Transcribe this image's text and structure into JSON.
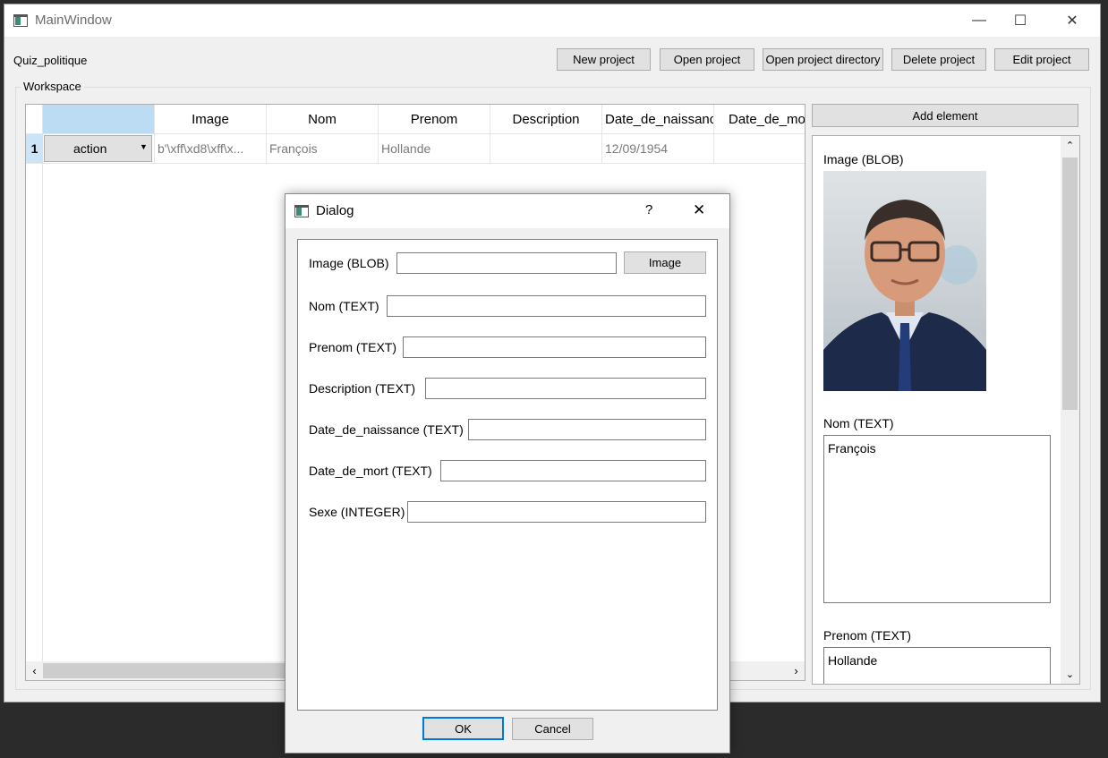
{
  "window": {
    "title": "MainWindow",
    "minimize_icon": "minimize-icon",
    "maximize_icon": "maximize-icon",
    "close_icon": "close-icon"
  },
  "toolbar": {
    "project_name": "Quiz_politique",
    "buttons": [
      "New project",
      "Open project",
      "Open project directory",
      "Delete project",
      "Edit project"
    ]
  },
  "workspace": {
    "group_label": "Workspace",
    "table": {
      "columns": [
        "Image",
        "Nom",
        "Prenom",
        "Description",
        "Date_de_naissance",
        "Date_de_mor"
      ],
      "rows": [
        {
          "row_number": "1",
          "action": "action",
          "cells": [
            "b'\\xff\\xd8\\xff\\x...",
            "François",
            "Hollande",
            "",
            "12/09/1954"
          ]
        }
      ]
    },
    "add_element_label": "Add element",
    "details": {
      "image_label": "Image (BLOB)",
      "nom_label": "Nom (TEXT)",
      "nom_value": "François",
      "prenom_label": "Prenom (TEXT)",
      "prenom_value": "Hollande"
    }
  },
  "dialog": {
    "title": "Dialog",
    "help_glyph": "?",
    "fields": [
      {
        "label": "Image (BLOB)",
        "value": ""
      },
      {
        "label": "Nom (TEXT)",
        "value": ""
      },
      {
        "label": "Prenom (TEXT)",
        "value": ""
      },
      {
        "label": "Description (TEXT)",
        "value": ""
      },
      {
        "label": "Date_de_naissance (TEXT)",
        "value": ""
      },
      {
        "label": "Date_de_mort (TEXT)",
        "value": ""
      },
      {
        "label": "Sexe (INTEGER)",
        "value": ""
      }
    ],
    "image_button": "Image",
    "ok_label": "OK",
    "cancel_label": "Cancel"
  },
  "colors": {
    "selection_header": "#bcdcf4",
    "row_header_selected": "#cce4f7",
    "button_face": "#e1e1e1",
    "default_button_border": "#0078d7",
    "app_icon": "#3c8b79"
  }
}
